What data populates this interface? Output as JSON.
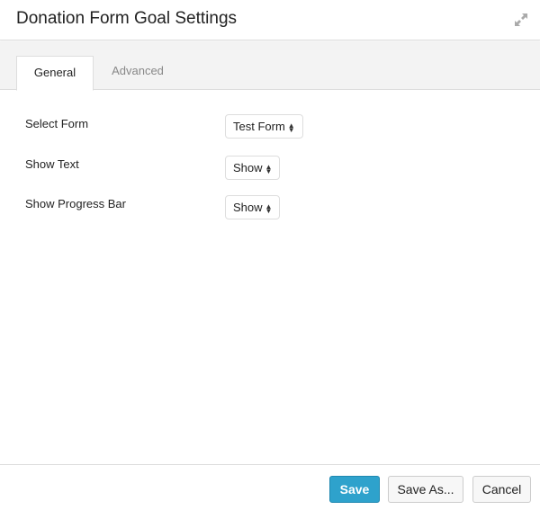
{
  "header": {
    "title": "Donation Form Goal Settings",
    "expand_icon": "expand-icon"
  },
  "tabs": [
    {
      "label": "General",
      "active": true
    },
    {
      "label": "Advanced",
      "active": false
    }
  ],
  "fields": [
    {
      "label": "Select Form",
      "value": "Test Form"
    },
    {
      "label": "Show Text",
      "value": "Show"
    },
    {
      "label": "Show Progress Bar",
      "value": "Show"
    }
  ],
  "footer": {
    "save": "Save",
    "save_as": "Save As...",
    "cancel": "Cancel"
  },
  "colors": {
    "primary": "#2ea2cc"
  }
}
